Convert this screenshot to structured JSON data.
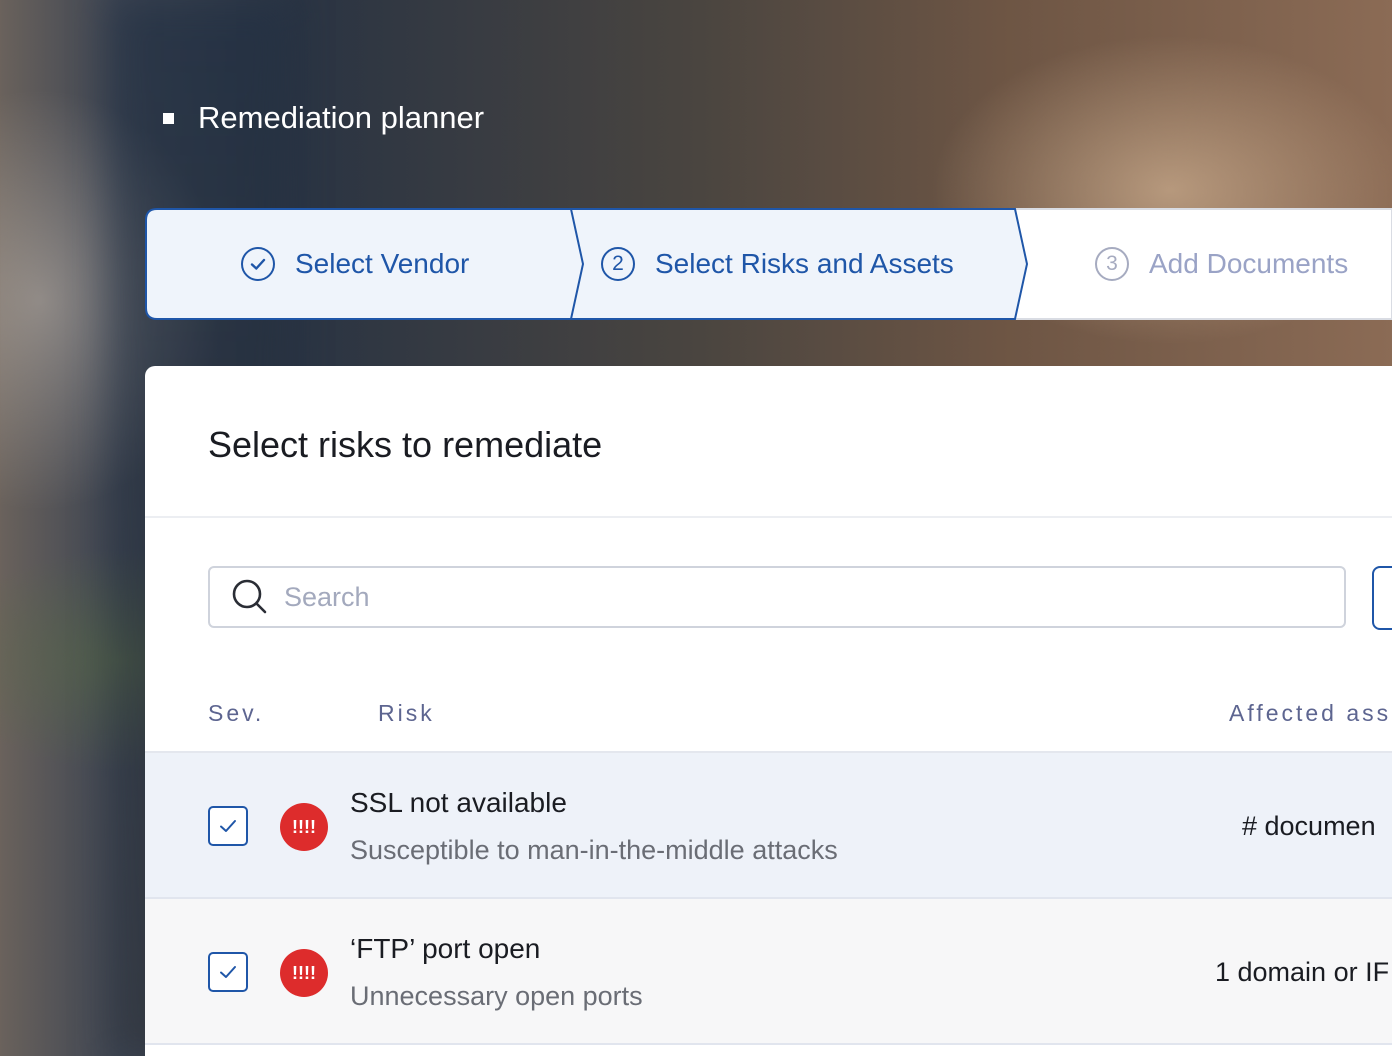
{
  "page": {
    "title": "Remediation planner"
  },
  "stepper": {
    "steps": [
      {
        "number": "",
        "label": "Select Vendor",
        "state": "completed",
        "icon": "check-circle-icon"
      },
      {
        "number": "2",
        "label": "Select Risks and Assets",
        "state": "current"
      },
      {
        "number": "3",
        "label": "Add Documents",
        "state": "upcoming"
      }
    ]
  },
  "card": {
    "title": "Select risks to remediate",
    "search": {
      "placeholder": "Search",
      "value": "",
      "icon": "search-icon"
    },
    "table": {
      "columns": [
        "Sev.",
        "Risk",
        "Affected ass"
      ],
      "rows": [
        {
          "checked": true,
          "severity_badge": "!!!!",
          "risk_title": "SSL not available",
          "risk_subtitle": "Susceptible to man-in-the-middle attacks",
          "affected": "# documen"
        },
        {
          "checked": true,
          "severity_badge": "!!!!",
          "risk_title": "‘FTP’ port open",
          "risk_subtitle": "Unnecessary open ports",
          "affected": "1 domain or IF"
        }
      ]
    }
  },
  "colors": {
    "accent": "#1f56a8",
    "severity_critical": "#dd2c2c",
    "selected_row": "#eef2f9",
    "step_active_fill": "#eff4fb",
    "muted_text": "#9aa3c6"
  }
}
